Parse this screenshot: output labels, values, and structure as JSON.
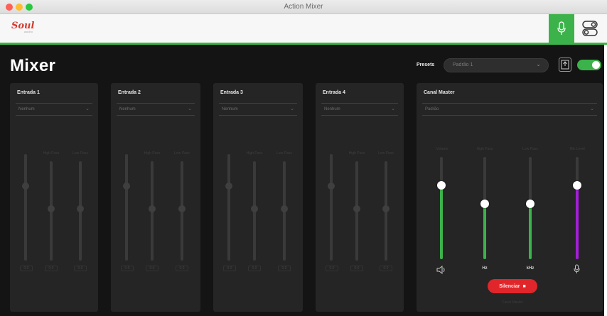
{
  "window": {
    "title": "Action Mixer"
  },
  "app": {
    "logo_text": "Soul",
    "logo_sub": "audio"
  },
  "colors": {
    "accent": "#3cb34a",
    "master_purple": "#a31ed6",
    "mute_red": "#e0262a"
  },
  "icons": {
    "mic_tab": "microphone-icon",
    "routing": "toggle-switches-icon",
    "save": "save-preset-icon",
    "speaker": "speaker-icon",
    "mic": "microphone-icon"
  },
  "header": {
    "title": "Mixer",
    "presets_label": "Presets",
    "presets_value": "Padrão 1",
    "enabled": true
  },
  "channels": [
    {
      "title": "Entrada 1",
      "select": "Nenhum",
      "labels": [
        "",
        "High Pass",
        "Low Pass"
      ],
      "values": [
        "0.0",
        "0.0",
        "0.0"
      ]
    },
    {
      "title": "Entrada 2",
      "select": "Nenhum",
      "labels": [
        "",
        "High Pass",
        "Low Pass"
      ],
      "values": [
        "0.0",
        "0.0",
        "0.0"
      ]
    },
    {
      "title": "Entrada 3",
      "select": "Nenhum",
      "labels": [
        "",
        "High Pass",
        "Low Pass"
      ],
      "values": [
        "0.0",
        "0.0",
        "0.0"
      ]
    },
    {
      "title": "Entrada 4",
      "select": "Nenhum",
      "labels": [
        "",
        "High Pass",
        "Low Pass"
      ],
      "values": [
        "0.0",
        "0.0",
        "0.0"
      ]
    }
  ],
  "master": {
    "title": "Canal Master",
    "select": "Padrão",
    "fader_labels": [
      "Volume",
      "High Pass",
      "Low Pass",
      "Mic Level"
    ],
    "fader_levels": [
      0.72,
      0.54,
      0.54,
      0.72
    ],
    "values": [
      "",
      "Hz",
      "kHz",
      ""
    ],
    "mute_label": "Silenciar",
    "footer": "Canal Master"
  }
}
